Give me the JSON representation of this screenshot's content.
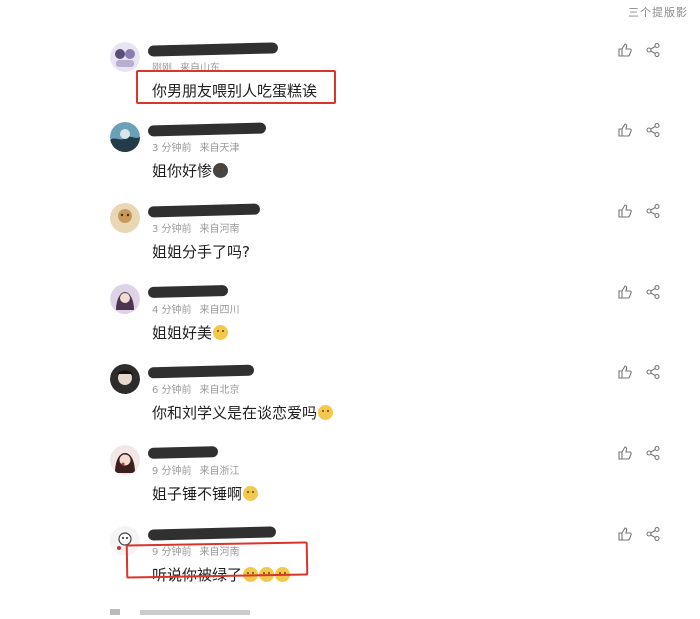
{
  "top_corner": "三个提版影",
  "comments": [
    {
      "name": "",
      "time": "刚刚",
      "location": "来自山东",
      "text": "你男朋友喂别人吃蛋糕诶",
      "emoji": 0,
      "highlighted": true
    },
    {
      "name": "",
      "time": "3 分钟前",
      "location": "来自天津",
      "text": "姐你好惨",
      "emoji": 1,
      "highlighted": false
    },
    {
      "name": "",
      "time": "3 分钟前",
      "location": "来自河南",
      "text": "姐姐分手了吗?",
      "emoji": 0,
      "highlighted": false
    },
    {
      "name": "",
      "time": "4 分钟前",
      "location": "来自四川",
      "text": "姐姐好美",
      "emoji": 1,
      "highlighted": false
    },
    {
      "name": "",
      "time": "6 分钟前",
      "location": "来自北京",
      "text": "你和刘学义是在谈恋爱吗",
      "emoji": 1,
      "highlighted": false
    },
    {
      "name": "",
      "time": "9 分钟前",
      "location": "来自浙江",
      "text": "姐子锤不锤啊",
      "emoji": 1,
      "highlighted": false
    },
    {
      "name": "",
      "time": "9 分钟前",
      "location": "来自河南",
      "text": "听说你被绿了",
      "emoji": 3,
      "highlighted": true
    }
  ],
  "icons": {
    "like": "thumbs-up-icon",
    "share": "share-icon"
  },
  "colors": {
    "highlight": "#d9352b",
    "meta": "#9a9a9a",
    "text": "#1f1f1f"
  }
}
